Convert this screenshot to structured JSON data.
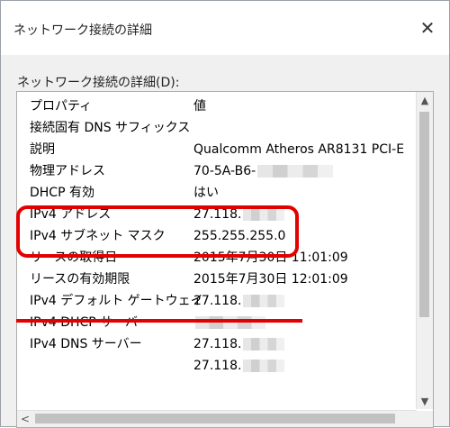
{
  "window": {
    "title": "ネットワーク接続の詳細",
    "close_glyph": "✕"
  },
  "group_label": "ネットワーク接続の詳細(D):",
  "list": {
    "header": {
      "property": "プロパティ",
      "value": "値"
    },
    "rows": [
      {
        "property": "接続固有 DNS サフィックス",
        "value": ""
      },
      {
        "property": "説明",
        "value": "Qualcomm Atheros AR8131 PCI-E"
      },
      {
        "property": "物理アドレス",
        "value": "70-5A-B6-"
      },
      {
        "property": "DHCP 有効",
        "value": "はい"
      },
      {
        "property": "IPv4 アドレス",
        "value": "27.118."
      },
      {
        "property": "IPv4 サブネット マスク",
        "value": "255.255.255.0"
      },
      {
        "property": "リースの取得日",
        "value": "2015年7月30日 11:01:09"
      },
      {
        "property": "リースの有効期限",
        "value": "2015年7月30日 12:01:09"
      },
      {
        "property": "IPv4 デフォルト ゲートウェイ",
        "value": "27.118."
      },
      {
        "property": "IPv4 DHCP サーバー",
        "value": ""
      },
      {
        "property": "IPv4 DNS サーバー",
        "value": "27.118."
      },
      {
        "property": "",
        "value": "27.118."
      }
    ]
  },
  "scroll": {
    "up": "▲",
    "down": "▼",
    "left": "<"
  },
  "colors": {
    "annotation": "#e30000"
  }
}
